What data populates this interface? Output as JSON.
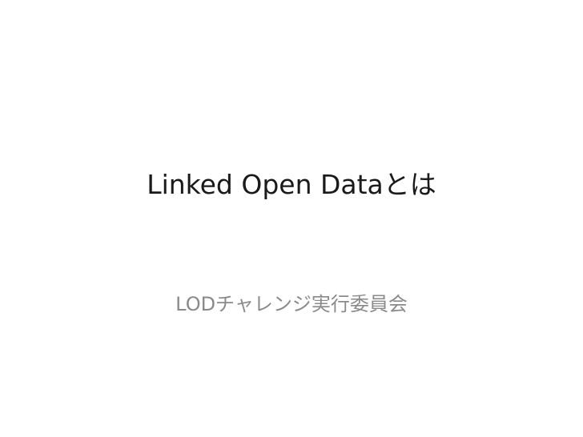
{
  "slide": {
    "title": "Linked Open Dataとは",
    "subtitle": "LODチャレンジ実行委員会"
  }
}
